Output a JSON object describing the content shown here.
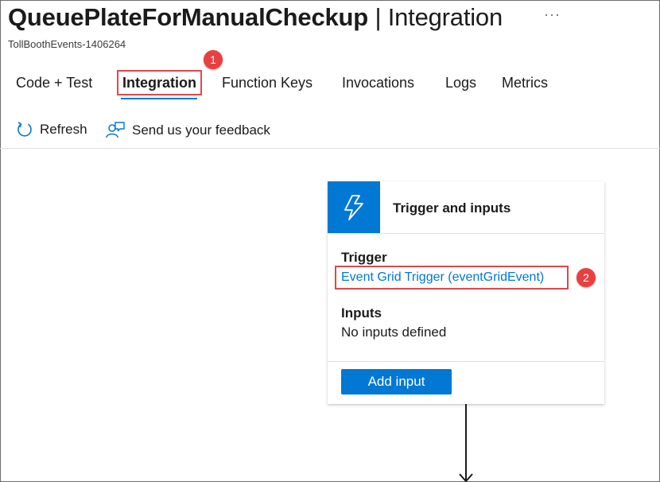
{
  "header": {
    "title_main": "QueuePlateForManualCheckup",
    "title_separator": "|",
    "title_section": "Integration",
    "more_label": "···",
    "subtitle": "TollBoothEvents-1406264"
  },
  "tabs": [
    {
      "label": "Code + Test",
      "active": false
    },
    {
      "label": "Integration",
      "active": true
    },
    {
      "label": "Function Keys",
      "active": false
    },
    {
      "label": "Invocations",
      "active": false
    },
    {
      "label": "Logs",
      "active": false
    },
    {
      "label": "Metrics",
      "active": false
    }
  ],
  "commands": {
    "refresh_label": "Refresh",
    "feedback_label": "Send us your feedback"
  },
  "annotations": {
    "step1": "1",
    "step2": "2",
    "color": "#e8403f"
  },
  "card": {
    "icon": "lightning-bolt-icon",
    "title": "Trigger and inputs",
    "trigger_heading": "Trigger",
    "trigger_link": "Event Grid Trigger (eventGridEvent)",
    "inputs_heading": "Inputs",
    "inputs_value": "No inputs defined",
    "add_input_label": "Add input"
  },
  "colors": {
    "accent": "#0078d4",
    "highlight": "#e0474c"
  }
}
